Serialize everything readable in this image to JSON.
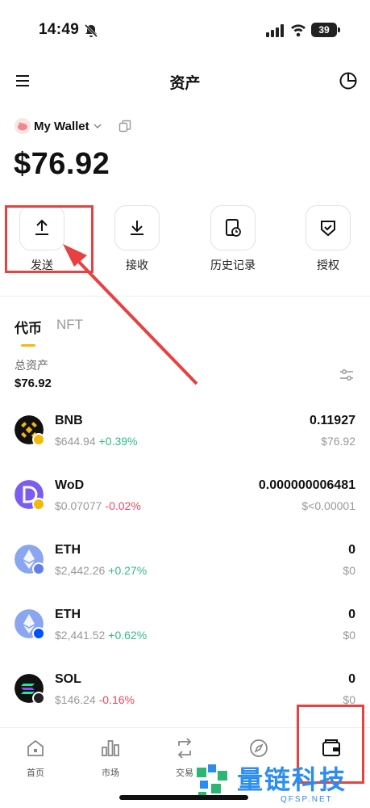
{
  "status_bar": {
    "time": "14:49",
    "battery": "39"
  },
  "header": {
    "title": "资产"
  },
  "wallet": {
    "name": "My Wallet",
    "balance": "$76.92"
  },
  "actions": [
    {
      "label": "发送",
      "icon": "upload-icon"
    },
    {
      "label": "接收",
      "icon": "download-icon"
    },
    {
      "label": "历史记录",
      "icon": "history-icon"
    },
    {
      "label": "授权",
      "icon": "shield-check-icon"
    }
  ],
  "tabs": [
    {
      "label": "代币",
      "active": true
    },
    {
      "label": "NFT",
      "active": false
    }
  ],
  "summary": {
    "label": "总资产",
    "value": "$76.92"
  },
  "tokens": [
    {
      "symbol": "BNB",
      "price": "$644.94",
      "change": "+0.39%",
      "amount": "0.11927",
      "usd": "$76.92"
    },
    {
      "symbol": "WoD",
      "price": "$0.07077",
      "change": "-0.02%",
      "amount": "0.000000006481",
      "usd": "$<0.00001"
    },
    {
      "symbol": "ETH",
      "price": "$2,442.26",
      "change": "+0.27%",
      "amount": "0",
      "usd": "$0"
    },
    {
      "symbol": "ETH",
      "price": "$2,441.52",
      "change": "+0.62%",
      "amount": "0",
      "usd": "$0"
    },
    {
      "symbol": "SOL",
      "price": "$146.24",
      "change": "-0.16%",
      "amount": "0",
      "usd": "$0"
    }
  ],
  "bottom_nav": [
    {
      "label": "首页",
      "icon": "home-icon"
    },
    {
      "label": "市场",
      "icon": "market-icon"
    },
    {
      "label": "交易",
      "icon": "swap-icon"
    },
    {
      "label": "",
      "icon": "compass-icon"
    },
    {
      "label": "",
      "icon": "wallet-icon"
    }
  ],
  "watermark": {
    "text": "量链科技",
    "sub": "QFSP.NET"
  },
  "colors": {
    "up": "#2ebd85",
    "down": "#f6465d",
    "accent": "#f0b90b",
    "annotation": "#e94040"
  }
}
